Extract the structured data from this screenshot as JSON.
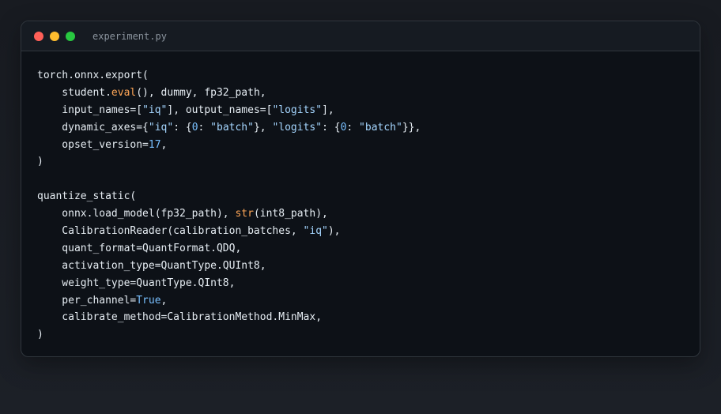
{
  "window": {
    "filename": "experiment.py",
    "traffic_lights": {
      "close": "#ff5f57",
      "minimize": "#febc2e",
      "maximize": "#28c840"
    }
  },
  "colors": {
    "background": "#0d1117",
    "default_text": "#e6edf3",
    "function_highlight": "#ffa657",
    "string": "#a5d6ff",
    "number": "#79c0ff",
    "keyword": "#79c0ff"
  },
  "code_lines": [
    [
      {
        "t": "torch.onnx.export(",
        "c": "plain"
      }
    ],
    [
      {
        "t": "    student.",
        "c": "plain"
      },
      {
        "t": "eval",
        "c": "fn"
      },
      {
        "t": "(), dummy, fp32_path,",
        "c": "plain"
      }
    ],
    [
      {
        "t": "    input_names=[",
        "c": "plain"
      },
      {
        "t": "\"iq\"",
        "c": "str"
      },
      {
        "t": "], output_names=[",
        "c": "plain"
      },
      {
        "t": "\"logits\"",
        "c": "str"
      },
      {
        "t": "],",
        "c": "plain"
      }
    ],
    [
      {
        "t": "    dynamic_axes={",
        "c": "plain"
      },
      {
        "t": "\"iq\"",
        "c": "str"
      },
      {
        "t": ": {",
        "c": "plain"
      },
      {
        "t": "0",
        "c": "num"
      },
      {
        "t": ": ",
        "c": "plain"
      },
      {
        "t": "\"batch\"",
        "c": "str"
      },
      {
        "t": "}, ",
        "c": "plain"
      },
      {
        "t": "\"logits\"",
        "c": "str"
      },
      {
        "t": ": {",
        "c": "plain"
      },
      {
        "t": "0",
        "c": "num"
      },
      {
        "t": ": ",
        "c": "plain"
      },
      {
        "t": "\"batch\"",
        "c": "str"
      },
      {
        "t": "}},",
        "c": "plain"
      }
    ],
    [
      {
        "t": "    opset_version=",
        "c": "plain"
      },
      {
        "t": "17",
        "c": "num"
      },
      {
        "t": ",",
        "c": "plain"
      }
    ],
    [
      {
        "t": ")",
        "c": "plain"
      }
    ],
    [
      {
        "t": "",
        "c": "plain"
      }
    ],
    [
      {
        "t": "quantize_static(",
        "c": "plain"
      }
    ],
    [
      {
        "t": "    onnx.load_model(fp32_path), ",
        "c": "plain"
      },
      {
        "t": "str",
        "c": "fn"
      },
      {
        "t": "(int8_path),",
        "c": "plain"
      }
    ],
    [
      {
        "t": "    CalibrationReader(calibration_batches, ",
        "c": "plain"
      },
      {
        "t": "\"iq\"",
        "c": "str"
      },
      {
        "t": "),",
        "c": "plain"
      }
    ],
    [
      {
        "t": "    quant_format=QuantFormat.QDQ,",
        "c": "plain"
      }
    ],
    [
      {
        "t": "    activation_type=QuantType.QUInt8,",
        "c": "plain"
      }
    ],
    [
      {
        "t": "    weight_type=QuantType.QInt8,",
        "c": "plain"
      }
    ],
    [
      {
        "t": "    per_channel=",
        "c": "plain"
      },
      {
        "t": "True",
        "c": "kw"
      },
      {
        "t": ",",
        "c": "plain"
      }
    ],
    [
      {
        "t": "    calibrate_method=CalibrationMethod.MinMax,",
        "c": "plain"
      }
    ],
    [
      {
        "t": ")",
        "c": "plain"
      }
    ]
  ]
}
